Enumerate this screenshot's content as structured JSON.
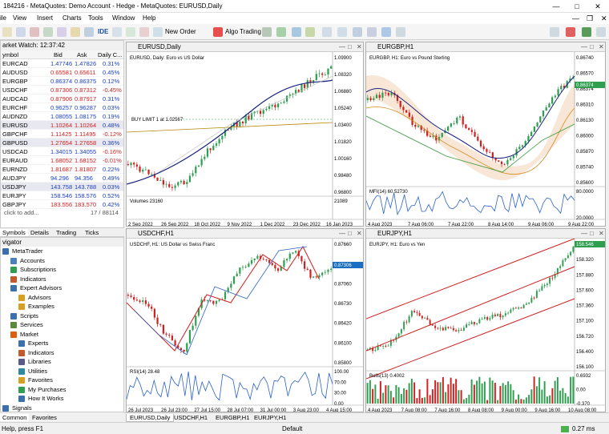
{
  "window": {
    "title": "184216 - MetaQuotes: Demo Account - Hedge - MetaQuotes: EURUSD,Daily"
  },
  "menu": [
    "ile",
    "View",
    "Insert",
    "Charts",
    "Tools",
    "Window",
    "Help"
  ],
  "toolbar": {
    "new_order": "New Order",
    "algo_trading": "Algo Trading",
    "ide": "IDE"
  },
  "market_watch": {
    "title": "arket Watch: 12:37:42",
    "headers": {
      "symbol": "ymbol",
      "bid": "Bid",
      "ask": "Ask",
      "change": "Daily C..."
    },
    "rows": [
      {
        "symbol": "EURCAD",
        "bid": "1.47746",
        "ask": "1.47826",
        "change": "0.31%",
        "dir": "up"
      },
      {
        "symbol": "AUDUSD",
        "bid": "0.65581",
        "ask": "0.65611",
        "change": "0.45%",
        "dir": "down"
      },
      {
        "symbol": "EURGBP",
        "bid": "0.86374",
        "ask": "0.86375",
        "change": "0.12%",
        "dir": "up"
      },
      {
        "symbol": "USDCHF",
        "bid": "0.87306",
        "ask": "0.87312",
        "change": "-0.45%",
        "dir": "down"
      },
      {
        "symbol": "AUDCAD",
        "bid": "0.87906",
        "ask": "0.87917",
        "change": "0.31%",
        "dir": "down"
      },
      {
        "symbol": "EURCHF",
        "bid": "0.96257",
        "ask": "0.96287",
        "change": "0.03%",
        "dir": "up"
      },
      {
        "symbol": "AUDNZD",
        "bid": "1.08055",
        "ask": "1.08175",
        "change": "0.19%",
        "dir": "up"
      },
      {
        "symbol": "EURUSD",
        "bid": "1.10264",
        "ask": "1.10264",
        "change": "0.48%",
        "dir": "down",
        "sel": true
      },
      {
        "symbol": "GBPCHF",
        "bid": "1.11425",
        "ask": "1.11495",
        "change": "-0.12%",
        "dir": "down"
      },
      {
        "symbol": "GBPUSD",
        "bid": "1.27654",
        "ask": "1.27658",
        "change": "0.36%",
        "dir": "down",
        "sel": true
      },
      {
        "symbol": "USDCAD",
        "bid": "1.34015",
        "ask": "1.34055",
        "change": "-0.16%",
        "dir": "up"
      },
      {
        "symbol": "EURAUD",
        "bid": "1.68052",
        "ask": "1.68152",
        "change": "-0.01%",
        "dir": "down"
      },
      {
        "symbol": "EURNZD",
        "bid": "1.81687",
        "ask": "1.81807",
        "change": "0.22%",
        "dir": "down"
      },
      {
        "symbol": "AUDJPY",
        "bid": "94.296",
        "ask": "94.356",
        "change": "0.49%",
        "dir": "up"
      },
      {
        "symbol": "USDJPY",
        "bid": "143.758",
        "ask": "143.788",
        "change": "0.03%",
        "dir": "up",
        "sel": true
      },
      {
        "symbol": "EURJPY",
        "bid": "158.546",
        "ask": "158.576",
        "change": "0.52%",
        "dir": "up"
      },
      {
        "symbol": "GBPJPY",
        "bid": "183.556",
        "ask": "183.570",
        "change": "0.42%",
        "dir": "down"
      }
    ],
    "footer_left": "click to add...",
    "footer_right": "17 / 88114",
    "tabs": [
      "Symbols",
      "Details",
      "Trading",
      "Ticks"
    ]
  },
  "navigator": {
    "title": "vigator",
    "items": [
      {
        "label": "MetaTrader",
        "color": "#3a6fb0"
      },
      {
        "label": "Accounts",
        "color": "#4a7fc0"
      },
      {
        "label": "Subscriptions",
        "color": "#2e9e4f"
      },
      {
        "label": "Indicators",
        "color": "#c45a2a"
      },
      {
        "label": "Expert Advisors",
        "color": "#3a6fb0"
      },
      {
        "label": "Advisors",
        "color": "#d8a020"
      },
      {
        "label": "Examples",
        "color": "#d8a020"
      },
      {
        "label": "Scripts",
        "color": "#3a6fb0"
      },
      {
        "label": "Services",
        "color": "#5a8a3a"
      },
      {
        "label": "Market",
        "color": "#e06010"
      },
      {
        "label": "Experts",
        "color": "#3a6fb0"
      },
      {
        "label": "Indicators",
        "color": "#c45a2a"
      },
      {
        "label": "Libraries",
        "color": "#5a5a8a"
      },
      {
        "label": "Utilities",
        "color": "#2a8aa0"
      },
      {
        "label": "Favorites",
        "color": "#d8a020"
      },
      {
        "label": "My Purchases",
        "color": "#2e9e4f"
      },
      {
        "label": "How It Works",
        "color": "#3a6fb0"
      },
      {
        "label": "Signals",
        "color": "#3a6fb0"
      }
    ],
    "tabs": [
      "Common",
      "Favorites"
    ]
  },
  "charts": {
    "eurusd": {
      "title": "EURUSD,Daily",
      "label": "EURUSD, Daily:  Euro vs US Dollar",
      "buy_limit": "BUY LIMIT 1 at 1.02567",
      "prices": [
        "1.09900",
        "1.08320",
        "1.06880",
        "1.05240",
        "1.03400",
        "1.01820",
        "1.00160",
        "0.98480",
        "0.96800"
      ],
      "indicator": "Volumes 23160",
      "ind_right": "21089",
      "dates": [
        "2 Sep 2022",
        "26 Sep 2022",
        "18 Oct 2022",
        "9 Nov 2022",
        "1 Dec 2022",
        "23 Dec 2022",
        "16 Jan 2023"
      ]
    },
    "eurgbp": {
      "title": "EURGBP,H1",
      "label": "EURGBP, H1:  Euro vs Pound Sterling",
      "prices": [
        "0.86740",
        "0.86570",
        "0.86374",
        "0.86310",
        "0.86130",
        "0.86000",
        "0.85870",
        "0.85740",
        "0.85600"
      ],
      "indicator": "MFI(14) 60.52730",
      "ind_right": [
        "80.0000",
        "20.0000"
      ],
      "dates": [
        "4 Aug 2023",
        "7 Aug 06:00",
        "7 Aug 22:00",
        "8 Aug 14:00",
        "9 Aug 06:00",
        "9 Aug 22:00"
      ]
    },
    "usdchf": {
      "title": "USDCHF,H1",
      "label": "USDCHF, H1:  US Dollar vs Swiss Franc",
      "prices": [
        "0.87660",
        "0.87306",
        "0.87060",
        "0.86730",
        "0.86420",
        "0.86100",
        "0.85800"
      ],
      "indicator": "RSI(14) 28.48",
      "ind_right": [
        "100.00",
        "70.00",
        "30.00",
        "0.00"
      ],
      "dates": [
        "26 Jul 2023",
        "26 Jul 23:00",
        "27 Jul 15:00",
        "28 Jul 07:00",
        "31 Jul 00:00",
        "3 Aug 23:00",
        "4 Aug 15:00"
      ]
    },
    "eurjpy": {
      "title": "EURJPY,H1",
      "label": "EURJPY, H1:  Euro vs Yen",
      "prices": [
        "158.546",
        "158.320",
        "157.880",
        "157.600",
        "157.360",
        "157.100",
        "156.720",
        "156.400",
        "156.100"
      ],
      "indicator": "Bulls(13) 0.4002",
      "ind_right": [
        "0.6932",
        "0.00",
        "-0.370"
      ],
      "dates": [
        "4 Aug 2023",
        "7 Aug 08:00",
        "7 Aug 16:00",
        "8 Aug 08:00",
        "9 Aug 00:00",
        "9 Aug 16:00",
        "10 Aug 08:00"
      ]
    }
  },
  "chart_tabs": [
    "EURUSD,Daily",
    "USDCHF,H1",
    "EURGBP,H1",
    "EURJPY,H1"
  ],
  "status": {
    "help": "Help, press F1",
    "profile": "Default",
    "ping": "0.27 ms"
  },
  "colors": {
    "up": "#2e9e4f",
    "down": "#d02020",
    "mw_up": "#1a3fc0",
    "mw_down": "#d02020"
  }
}
